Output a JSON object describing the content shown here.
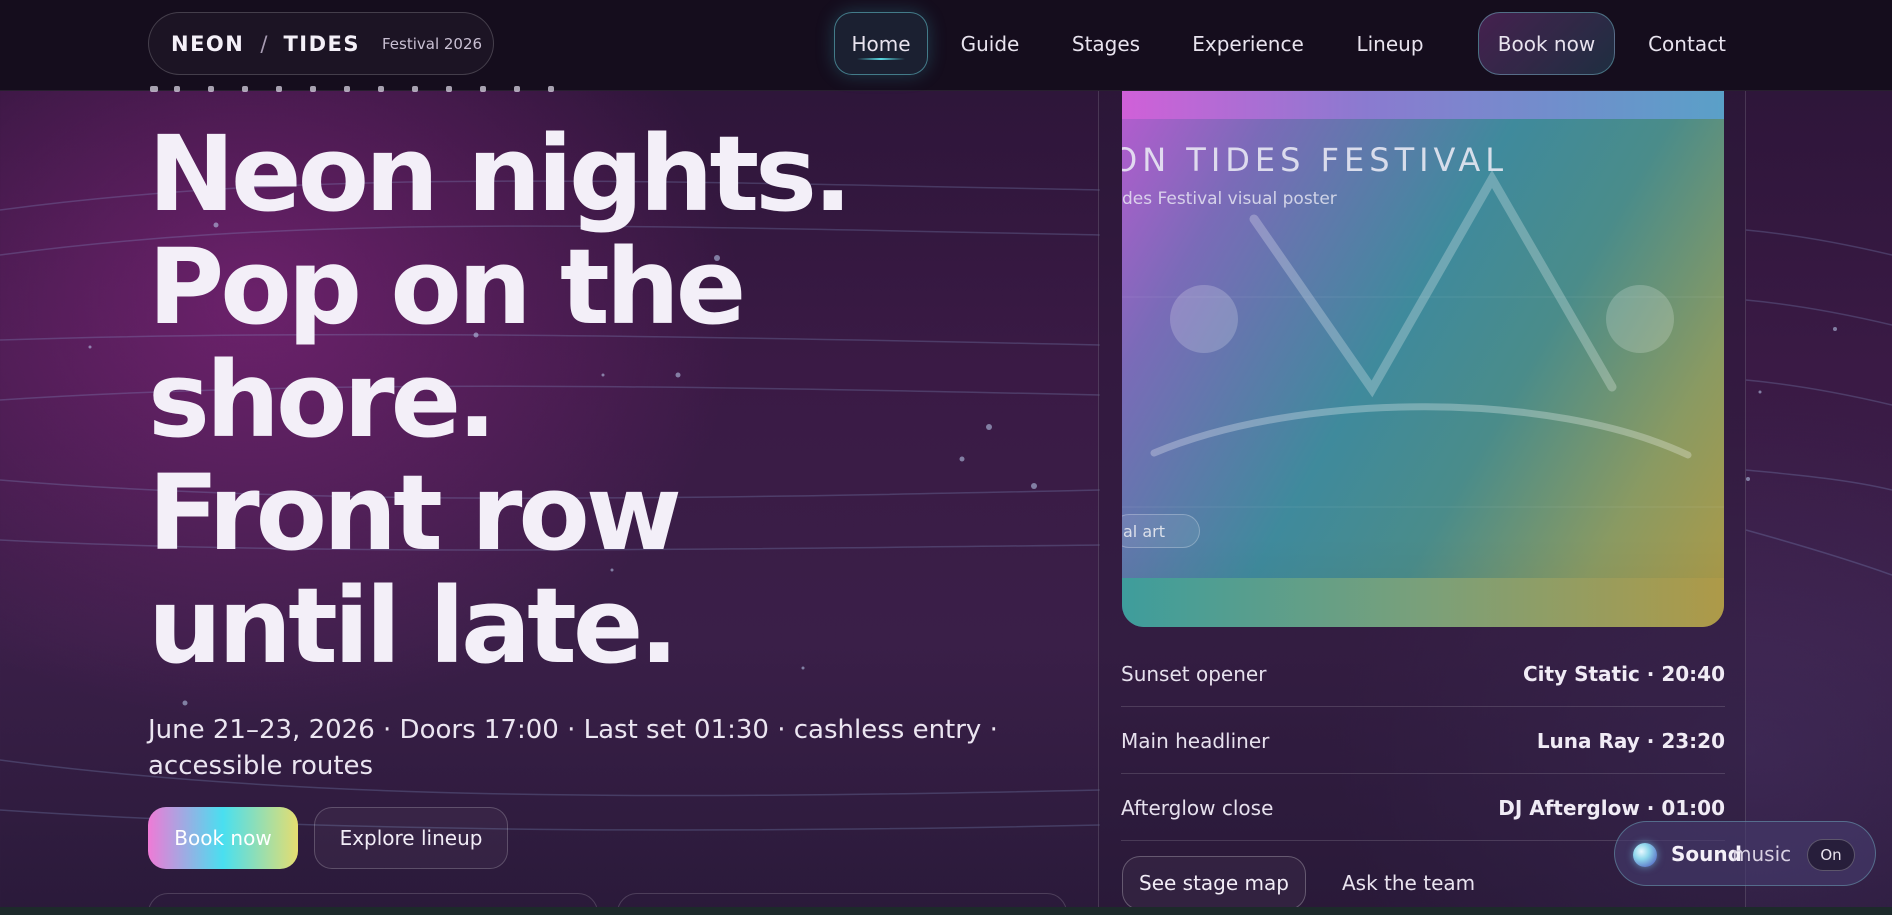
{
  "brand": {
    "part1": "NEON",
    "separator": "/",
    "part2": "TIDES",
    "tag": "Festival 2026"
  },
  "nav": {
    "items": [
      {
        "label": "Home",
        "active": true
      },
      {
        "label": "Guide"
      },
      {
        "label": "Stages"
      },
      {
        "label": "Experience"
      },
      {
        "label": "Lineup"
      },
      {
        "label": "Book now",
        "cta": true
      },
      {
        "label": "Contact"
      }
    ]
  },
  "hero": {
    "headline_lines": [
      "Neon nights.",
      "Pop on the",
      "shore.",
      "Front row",
      "until late."
    ],
    "details": "June 21–23, 2026 · Doors 17:00 · Last set 01:30 · cashless entry · accessible routes",
    "primary_button": "Book now",
    "secondary_button": "Explore lineup"
  },
  "poster": {
    "title": "ON TIDES FESTIVAL",
    "subtitle": "des Festival visual poster",
    "tag": "al art"
  },
  "schedule": [
    {
      "label": "Sunset opener",
      "value": "City Static · 20:40"
    },
    {
      "label": "Main headliner",
      "value": "Luna Ray · 23:20"
    },
    {
      "label": "Afterglow close",
      "value": "DJ Afterglow · 01:00"
    }
  ],
  "panel_actions": {
    "map_button": "See stage map",
    "ask_link": "Ask the team"
  },
  "sound": {
    "bold": "Sound",
    "rest": "music",
    "toggle": "On"
  },
  "colors": {
    "accent_cyan": "#58d7e0",
    "accent_pink": "#ef7ad6",
    "accent_yellow": "#e5dd70",
    "header_bg": "#150d1d"
  },
  "icons": {
    "sound": "sound-orb-icon"
  }
}
